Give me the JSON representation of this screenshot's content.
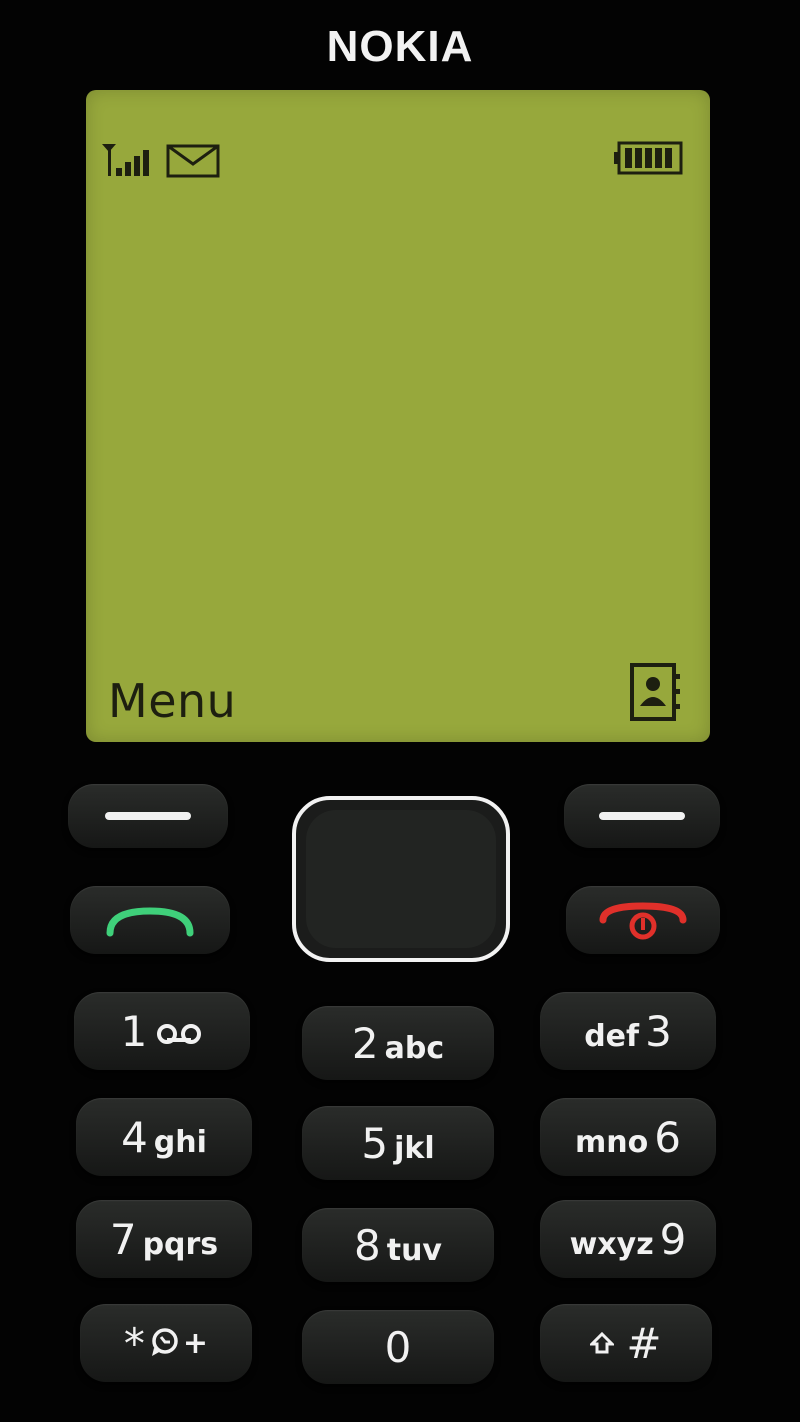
{
  "brand": "NOKIA",
  "screen": {
    "softkey_left": "Menu",
    "icons": [
      "signal-icon",
      "envelope-icon",
      "battery-icon",
      "contacts-icon"
    ],
    "color": "#97a83c"
  },
  "keypad": {
    "key1": {
      "num": "1",
      "letters": "ഠാ"
    },
    "key2": {
      "num": "2",
      "letters": "abc"
    },
    "key3": {
      "num": "3",
      "letters": "def"
    },
    "key4": {
      "num": "4",
      "letters": "ghi"
    },
    "key5": {
      "num": "5",
      "letters": "jkl"
    },
    "key6": {
      "num": "6",
      "letters": "mno"
    },
    "key7": {
      "num": "7",
      "letters": "pqrs"
    },
    "key8": {
      "num": "8",
      "letters": "tuv"
    },
    "key9": {
      "num": "9",
      "letters": "wxyz"
    },
    "star": {
      "num": "*",
      "extra": "+"
    },
    "key0": {
      "num": "0"
    },
    "hash": {
      "num": "#"
    }
  },
  "colors": {
    "call": "#3fd07a",
    "end": "#e0302a"
  }
}
